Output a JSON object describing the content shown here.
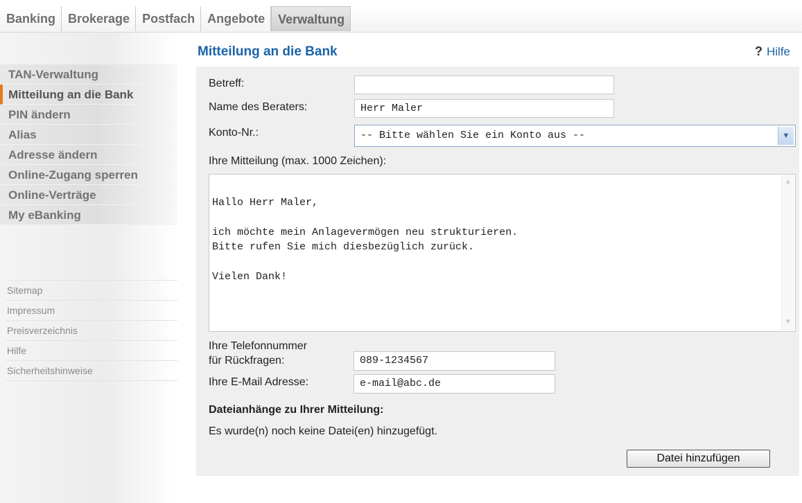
{
  "tabs": [
    "Banking",
    "Brokerage",
    "Postfach",
    "Angebote",
    "Verwaltung"
  ],
  "active_tab": "Verwaltung",
  "sidebar": {
    "items": [
      {
        "label": "TAN-Verwaltung"
      },
      {
        "label": "Mitteilung an die Bank"
      },
      {
        "label": "PIN ändern"
      },
      {
        "label": "Alias"
      },
      {
        "label": "Adresse ändern"
      },
      {
        "label": "Online-Zugang sperren"
      },
      {
        "label": "Online-Verträge"
      },
      {
        "label": "My eBanking"
      }
    ],
    "active_item": "Mitteilung an die Bank",
    "links": [
      "Sitemap",
      "Impressum",
      "Preisverzeichnis",
      "Hilfe",
      "Sicherheitshinweise"
    ]
  },
  "header": {
    "title": "Mitteilung an die Bank",
    "help_label": "Hilfe",
    "help_icon": "help-question-icon"
  },
  "form": {
    "subject_label": "Betreff:",
    "subject_value": "",
    "advisor_label": "Name des Beraters:",
    "advisor_value": "Herr Maler",
    "account_label": "Konto-Nr.:",
    "account_selected": "-- Bitte wählen Sie ein Konto aus --",
    "message_label": "Ihre Mitteilung (max. 1000 Zeichen):",
    "message_value": "Hallo Herr Maler,\n\nich möchte mein Anlagevermögen neu strukturieren.\nBitte rufen Sie mich diesbezüglich zurück.\n\nVielen Dank!",
    "phone_label_line1": "Ihre Telefonnummer",
    "phone_label_line2": "für Rückfragen:",
    "phone_value": "089-1234567",
    "email_label": "Ihre E-Mail Adresse:",
    "email_value": "e-mail@abc.de",
    "attachments_title": "Dateianhänge zu Ihrer Mitteilung:",
    "attachments_status": "Es wurde(n) noch keine Datei(en) hinzugefügt.",
    "add_file_button": "Datei hinzufügen"
  },
  "colors": {
    "accent": "#e57a1e",
    "title_blue": "#1b63a8",
    "panel_bg": "#efefef"
  }
}
